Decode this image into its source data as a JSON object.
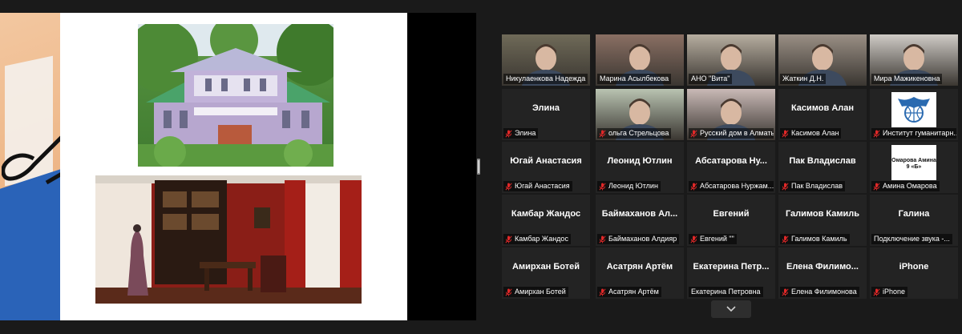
{
  "gallery": {
    "rows": [
      [
        {
          "name": "Никулаенкова Надежда",
          "display": "",
          "video": true,
          "muted": false,
          "active": true,
          "bg": "#6f6a58"
        },
        {
          "name": "Марина Асылбекова",
          "display": "",
          "video": true,
          "muted": false,
          "active": false,
          "bg": "#8a6f63"
        },
        {
          "name": "АНО \"Вита\"",
          "display": "",
          "video": true,
          "muted": false,
          "active": false,
          "bg": "#b7aea0"
        },
        {
          "name": "Жаткин Д.Н.",
          "display": "",
          "video": true,
          "muted": false,
          "active": false,
          "bg": "#9a8f85"
        },
        {
          "name": "Мира Мажикеновна",
          "display": "",
          "video": true,
          "muted": false,
          "active": false,
          "bg": "#cfcbc6"
        }
      ],
      [
        {
          "name": "Элина",
          "display": "Элина",
          "video": false,
          "muted": true,
          "active": false
        },
        {
          "name": "ольга Стрельцова",
          "display": "",
          "video": true,
          "muted": true,
          "active": false,
          "bg": "#b9c3b1"
        },
        {
          "name": "Русский дом в Алматы",
          "display": "",
          "video": true,
          "muted": true,
          "active": false,
          "bg": "#c9b9b6"
        },
        {
          "name": "Касимов Алан",
          "display": "Касимов Алан",
          "video": false,
          "muted": true,
          "active": false
        },
        {
          "name": "Институт гуманитарн...",
          "display": "",
          "video": false,
          "muted": true,
          "active": false,
          "logo": "institute"
        }
      ],
      [
        {
          "name": "Югай Анастасия",
          "display": "Югай Анастасия",
          "video": false,
          "muted": true,
          "active": false
        },
        {
          "name": "Леонид Ютлин",
          "display": "Леонид Ютлин",
          "video": false,
          "muted": true,
          "active": false
        },
        {
          "name": "Абсатарова Нуржам...",
          "display": "Абсатарова Ну...",
          "video": false,
          "muted": true,
          "active": false
        },
        {
          "name": "Пак Владислав",
          "display": "Пак Владислав",
          "video": false,
          "muted": true,
          "active": false
        },
        {
          "name": "Амина Омарова",
          "display": "",
          "video": false,
          "muted": true,
          "active": false,
          "logo": "amina",
          "logo_text": "Омарова Амина 9 «Б»"
        }
      ],
      [
        {
          "name": "Камбар Жандос",
          "display": "Камбар Жандос",
          "video": false,
          "muted": true,
          "active": false
        },
        {
          "name": "Баймаханов Алдияр",
          "display": "Баймаханов Ал...",
          "video": false,
          "muted": true,
          "active": false
        },
        {
          "name": "Евгений \"\"",
          "display": "Евгений",
          "video": false,
          "muted": true,
          "active": false
        },
        {
          "name": "Галимов Камиль",
          "display": "Галимов Камиль",
          "video": false,
          "muted": true,
          "active": false
        },
        {
          "name": "Подключение звука -...",
          "display": "Галина",
          "video": false,
          "muted": false,
          "active": false
        }
      ],
      [
        {
          "name": "Амирхан Ботей",
          "display": "Амирхан Ботей",
          "video": false,
          "muted": true,
          "active": false
        },
        {
          "name": "Асатрян Артём",
          "display": "Асатрян Артём",
          "video": false,
          "muted": true,
          "active": false
        },
        {
          "name": "Екатерина Петровна",
          "display": "Екатерина Петр...",
          "video": false,
          "muted": false,
          "active": false
        },
        {
          "name": "Елена Филимонова",
          "display": "Елена Филимо...",
          "video": false,
          "muted": true,
          "active": false
        },
        {
          "name": "iPhone",
          "display": "iPhone",
          "video": false,
          "muted": true,
          "active": false
        }
      ]
    ]
  },
  "colors": {
    "background": "#1a1a1a",
    "tile": "#232323",
    "active_border": "#d7e24a",
    "muted_mic": "#e02828"
  }
}
